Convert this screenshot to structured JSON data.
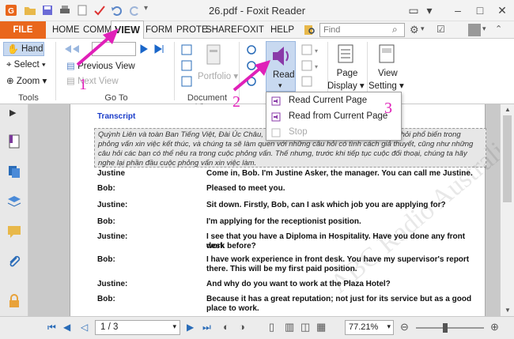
{
  "window": {
    "title": "26.pdf - Foxit Reader"
  },
  "menu": {
    "tabs": [
      "FILE",
      "HOME",
      "COMM",
      "VIEW",
      "FORM",
      "PROTE",
      "SHARE",
      "FOXIT",
      "HELP"
    ],
    "find_placeholder": "Find"
  },
  "ribbon": {
    "tools": {
      "label": "Tools",
      "hand": "Hand",
      "select": "Select",
      "zoom": "Zoom"
    },
    "goto": {
      "label": "Go To",
      "prev_view": "Previous View",
      "next_view": "Next View"
    },
    "document_views": {
      "label": "Document Views",
      "portfolio": "Portfolio"
    },
    "read": {
      "label": "Read"
    },
    "page_display": {
      "label_line1": "Page",
      "label_line2": "Display"
    },
    "view_setting": {
      "label_line1": "View",
      "label_line2": "Setting"
    }
  },
  "read_menu": {
    "items": [
      "Read Current Page",
      "Read from Current Page",
      "Stop"
    ]
  },
  "annotations": {
    "one": "1",
    "two": "2",
    "three": "3"
  },
  "document": {
    "heading": "Transcript",
    "intro": "Quỳnh Liên và toàn Ban Tiếng Việt, Đài Úc Châu, thân ... Chúng ta sẽ tìm hiểu một số câu hỏi phổ biến trong phỏng vấn xin việc kết thúc, và chúng ta sẽ làm quen với những câu hỏi có tình cách giả thuyết, cũng như những câu hỏi các bạn có thể nêu ra trong cuộc phỏng vấn. Thế nhưng, trước khi tiếp tục cuộc đối thoại, chúng ta hãy nghe lại phần đầu cuộc phỏng vấn xin việc làm.",
    "dialogue": [
      {
        "speaker": "Justine",
        "line1": "Come in, Bob. I'm Justine Asker, the manager. You can call me Justine.",
        "line2": ""
      },
      {
        "speaker": "Bob:",
        "line1": "Pleased to meet you.",
        "line2": ""
      },
      {
        "speaker": "Justine:",
        "line1": "Sit down. Firstly, Bob, can I ask which job you are applying for?",
        "line2": ""
      },
      {
        "speaker": "Bob:",
        "line1": "I'm applying for the receptionist position.",
        "line2": ""
      },
      {
        "speaker": "Justine:",
        "line1": "I see that you have a Diploma in Hospitality. Have you done any front desk",
        "line2": "work before?"
      },
      {
        "speaker": "Bob:",
        "line1": "I have work experience in front desk. You have my supervisor's report",
        "line2": "there. This will be my first paid position."
      },
      {
        "speaker": "Justine:",
        "line1": "And why do you want to work at the Plaza Hotel?",
        "line2": ""
      },
      {
        "speaker": "Bob:",
        "line1": "Because it has a great reputation; not just for its service but as a good",
        "line2": "place to work."
      }
    ],
    "watermark": "ABC Radio Australia"
  },
  "status": {
    "page": "1 / 3",
    "zoom": "77.21%"
  },
  "colors": {
    "file_tab": "#e9661c",
    "accent_pink": "#e020b8",
    "read_icon": "#8a3aa8",
    "link_blue": "#1a3cc9"
  }
}
